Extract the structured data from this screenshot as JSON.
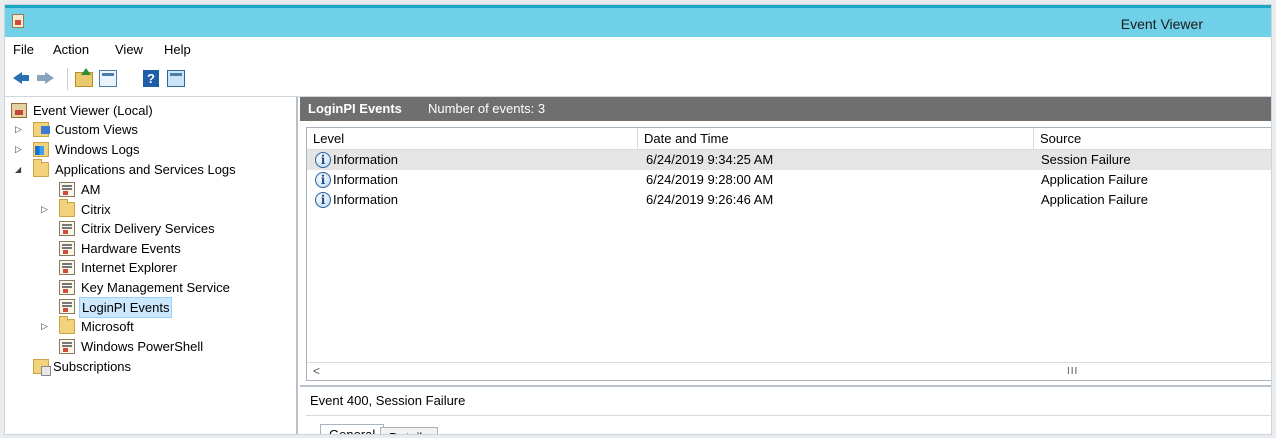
{
  "window": {
    "title": "Event Viewer"
  },
  "menu": [
    "File",
    "Action",
    "View",
    "Help"
  ],
  "toolbar": {
    "icons": [
      "back-arrow-icon",
      "forward-arrow-icon",
      "up-folder-icon",
      "show-hide-tree-icon",
      "help-icon",
      "show-hide-action-pane-icon"
    ]
  },
  "tree": {
    "root": "Event Viewer (Local)",
    "custom_views": "Custom Views",
    "windows_logs": "Windows Logs",
    "apps_services": "Applications and Services Logs",
    "children": [
      "AM",
      "Citrix",
      "Citrix Delivery Services",
      "Hardware Events",
      "Internet Explorer",
      "Key Management Service",
      "LoginPI Events",
      "Microsoft",
      "Windows PowerShell"
    ],
    "subscriptions": "Subscriptions",
    "selected": "LoginPI Events"
  },
  "pane": {
    "title": "LoginPI Events",
    "count_text": "Number of events: 3"
  },
  "grid": {
    "columns": [
      "Level",
      "Date and Time",
      "Source"
    ],
    "rows": [
      {
        "level": "Information",
        "datetime": "6/24/2019 9:34:25 AM",
        "source": "Session Failure"
      },
      {
        "level": "Information",
        "datetime": "6/24/2019 9:28:00 AM",
        "source": "Application Failure"
      },
      {
        "level": "Information",
        "datetime": "6/24/2019 9:26:46 AM",
        "source": "Application Failure"
      }
    ],
    "scroll_left": "<",
    "scroll_thumb": "III"
  },
  "detail": {
    "title": "Event 400, Session Failure",
    "tabs": [
      "General",
      "Details"
    ]
  },
  "colors": {
    "titlebar": "#6fd0e8",
    "pane_header": "#6f6f6f",
    "selection": "#cce8ff"
  }
}
